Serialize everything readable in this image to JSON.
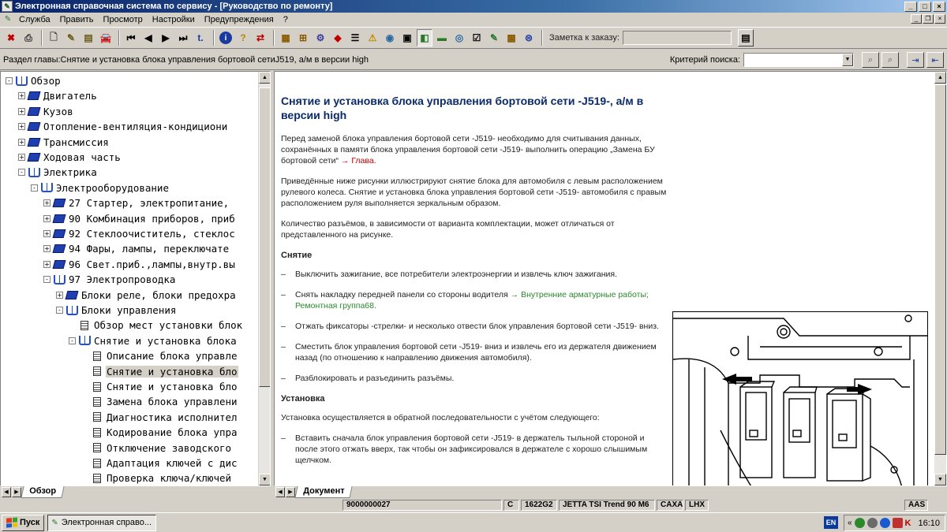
{
  "window": {
    "title": "Электронная справочная система по сервису - [Руководство по ремонту]"
  },
  "menu": {
    "items": [
      "Служба",
      "Править",
      "Просмотр",
      "Настройки",
      "Предупреждения",
      "?"
    ]
  },
  "toolbar": {
    "order_note_label": "Заметка к заказу:",
    "order_note_value": ""
  },
  "pathbar": {
    "chapter_section": "Раздел главы:Снятие и установка блока управления бортовой сетиJ519, а/м в версии high",
    "search_label": "Критерий поиска:",
    "search_value": ""
  },
  "tree": {
    "items": [
      {
        "label": "Обзор",
        "level": 0,
        "icon": "book-open",
        "toggle": "-"
      },
      {
        "label": "Двигатель",
        "level": 1,
        "icon": "book-closed",
        "toggle": "+"
      },
      {
        "label": "Кузов",
        "level": 1,
        "icon": "book-closed",
        "toggle": "+"
      },
      {
        "label": "Отопление-вентиляция-кондициони",
        "level": 1,
        "icon": "book-closed",
        "toggle": "+"
      },
      {
        "label": "Трансмиссия",
        "level": 1,
        "icon": "book-closed",
        "toggle": "+"
      },
      {
        "label": "Ходовая часть",
        "level": 1,
        "icon": "book-closed",
        "toggle": "+"
      },
      {
        "label": "Электрика",
        "level": 1,
        "icon": "book-open",
        "toggle": "-"
      },
      {
        "label": "Электрооборудование",
        "level": 2,
        "icon": "book-open",
        "toggle": "-"
      },
      {
        "label": "27 Стартер, электропитание,",
        "level": 3,
        "icon": "book-closed",
        "toggle": "+"
      },
      {
        "label": "90 Комбинация приборов, приб",
        "level": 3,
        "icon": "book-closed",
        "toggle": "+"
      },
      {
        "label": "92 Стеклоочиститель, стеклос",
        "level": 3,
        "icon": "book-closed",
        "toggle": "+"
      },
      {
        "label": "94 Фары, лампы, переключате",
        "level": 3,
        "icon": "book-closed",
        "toggle": "+"
      },
      {
        "label": "96 Свет.приб.,лампы,внутр.вы",
        "level": 3,
        "icon": "book-closed",
        "toggle": "+"
      },
      {
        "label": "97 Электропроводка",
        "level": 3,
        "icon": "book-open",
        "toggle": "-"
      },
      {
        "label": "Блоки реле, блоки предохра",
        "level": 4,
        "icon": "book-closed",
        "toggle": "+"
      },
      {
        "label": "Блоки управления",
        "level": 4,
        "icon": "book-open",
        "toggle": "-"
      },
      {
        "label": "Обзор мест установки блок",
        "level": 5,
        "icon": "doc",
        "toggle": ""
      },
      {
        "label": "Снятие и установка блока",
        "level": 5,
        "icon": "book-open",
        "toggle": "-"
      },
      {
        "label": "Описание блока управле",
        "level": 6,
        "icon": "doc",
        "toggle": ""
      },
      {
        "label": "Снятие и установка бло",
        "level": 6,
        "icon": "doc",
        "toggle": "",
        "selected": true
      },
      {
        "label": "Снятие и установка бло",
        "level": 6,
        "icon": "doc",
        "toggle": ""
      },
      {
        "label": "Замена блока управлени",
        "level": 6,
        "icon": "doc",
        "toggle": ""
      },
      {
        "label": "Диагностика исполнител",
        "level": 6,
        "icon": "doc",
        "toggle": ""
      },
      {
        "label": "Кодирование блока упра",
        "level": 6,
        "icon": "doc",
        "toggle": ""
      },
      {
        "label": "Отключение заводского",
        "level": 6,
        "icon": "doc",
        "toggle": ""
      },
      {
        "label": "Адаптация ключей с дис",
        "level": 6,
        "icon": "doc",
        "toggle": ""
      },
      {
        "label": "Проверка ключа/ключей",
        "level": 6,
        "icon": "doc",
        "toggle": ""
      }
    ]
  },
  "tabs": {
    "left": "Обзор",
    "right": "Документ"
  },
  "document": {
    "title": "Снятие и установка блока управления бортовой сети -J519-, а/м в версии high",
    "p1": "Перед заменой блока управления бортовой сети -J519- необходимо для считывания данных, сохранённых в памяти блока управления бортовой сети -J519- выполнить операцию „Замена БУ бортовой сети“",
    "p1_link": "→ Глава.",
    "p2": "Приведённые ниже рисунки иллюстрируют снятие блока для автомобиля с левым расположением рулевого колеса. Снятие и установка блока управления бортовой сети -J519- автомобиля с правым расположением руля выполняется зеркальным образом.",
    "p3": "Количество разъёмов, в зависимости от варианта комплектации, может отличаться от представленного на рисунке.",
    "removal_heading": "Снятие",
    "dash": "–",
    "step1": "Выключить зажигание, все потребители электроэнергии и извлечь ключ зажигания.",
    "step2": "Снять накладку передней панели со стороны водителя",
    "step2_link": "→ Внутренние арматурные работы; Ремонтная группа68.",
    "step3": "Отжать фиксаторы -стрелки- и несколько отвести блок управления бортовой сети -J519- вниз.",
    "step4": "Сместить блок управления бортовой сети -J519- вниз и извлечь его из держателя движением назад (по отношению к направлению движения автомобиля).",
    "step5": "Разблокировать и разъединить разъёмы.",
    "install_heading": "Установка",
    "p4": "Установка осуществляется в обратной последовательности с учётом следующего:",
    "step6": "Вставить сначала блок управления бортовой сети -J519- в держатель тыльной стороной и после этого отжать вверх, так чтобы он зафиксировался в держателе с хорошо слышимым щелчком."
  },
  "status": {
    "order_no": "9000000027",
    "c": "C",
    "code": "1622G2",
    "model": "JETTA TSI Trend 90 M6",
    "engine": "CAXA",
    "gearbox": "LHX",
    "aas": "AAS"
  },
  "taskbar": {
    "start": "Пуск",
    "task": "Электронная справо...",
    "lang": "EN",
    "time": "16:10"
  },
  "colors": {
    "title_dark": "#0a246a",
    "doc_heading": "#0a2a6a",
    "link_red": "#c00000",
    "link_green": "#2a8a2a",
    "book_blue": "#1f3fb0"
  }
}
